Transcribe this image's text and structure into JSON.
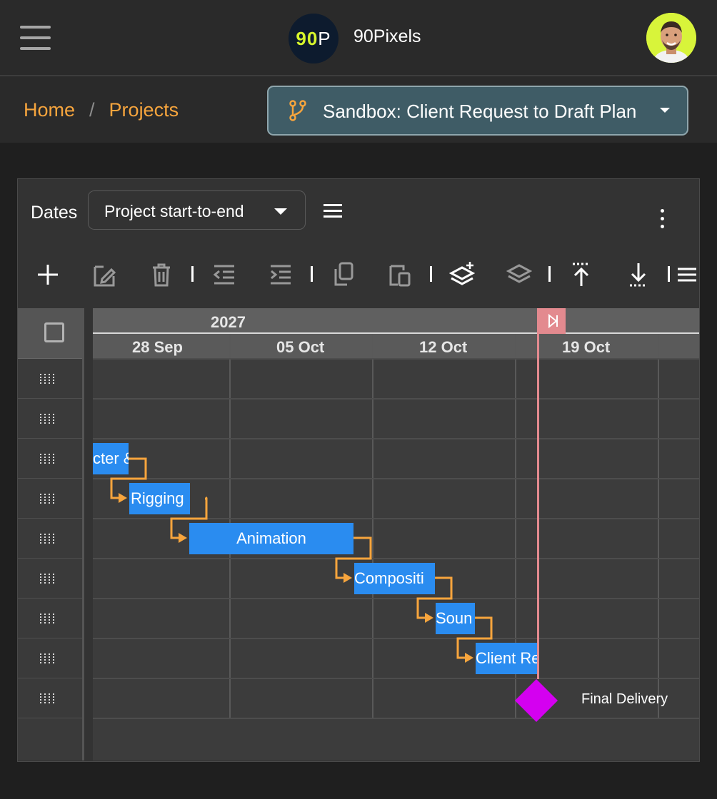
{
  "app": {
    "logo_number": "90",
    "logo_letter": "P",
    "brand_name": "90Pixels"
  },
  "breadcrumb": {
    "home": "Home",
    "separator": "/",
    "projects": "Projects"
  },
  "sandbox": {
    "label": "Sandbox: Client Request to Draft Plan"
  },
  "toolbar": {
    "dates_label": "Dates",
    "dates_value": "Project start-to-end"
  },
  "gantt": {
    "year": "2027",
    "weeks": [
      "28 Sep",
      "05 Oct",
      "12 Oct",
      "19 Oct"
    ],
    "tasks": [
      {
        "name": "Character & Rig Setup",
        "visible": "cter &"
      },
      {
        "name": "Rigging",
        "visible": "Rigging"
      },
      {
        "name": "Animation",
        "visible": "Animation"
      },
      {
        "name": "Compositing",
        "visible": "Compositi"
      },
      {
        "name": "Sound",
        "visible": "Soun"
      },
      {
        "name": "Client Review",
        "visible": "Client Re"
      }
    ],
    "milestone": "Final Delivery"
  },
  "colors": {
    "accent": "#f7a53d",
    "task_bar": "#2a8cf0",
    "dependency": "#f7a53d",
    "milestone": "#d400f0",
    "today_marker": "#e38a8f",
    "sandbox_bg": "#3f5c66"
  },
  "icons": [
    "hamburger-icon",
    "branch-icon",
    "plus-icon",
    "edit-icon",
    "trash-icon",
    "outdent-icon",
    "indent-icon",
    "copy-icon",
    "paste-icon",
    "add-layer-icon",
    "layers-icon",
    "move-to-top-icon",
    "move-to-bottom-icon",
    "list-icon",
    "more-vertical-icon",
    "drag-handle-icon",
    "today-flag-icon"
  ]
}
